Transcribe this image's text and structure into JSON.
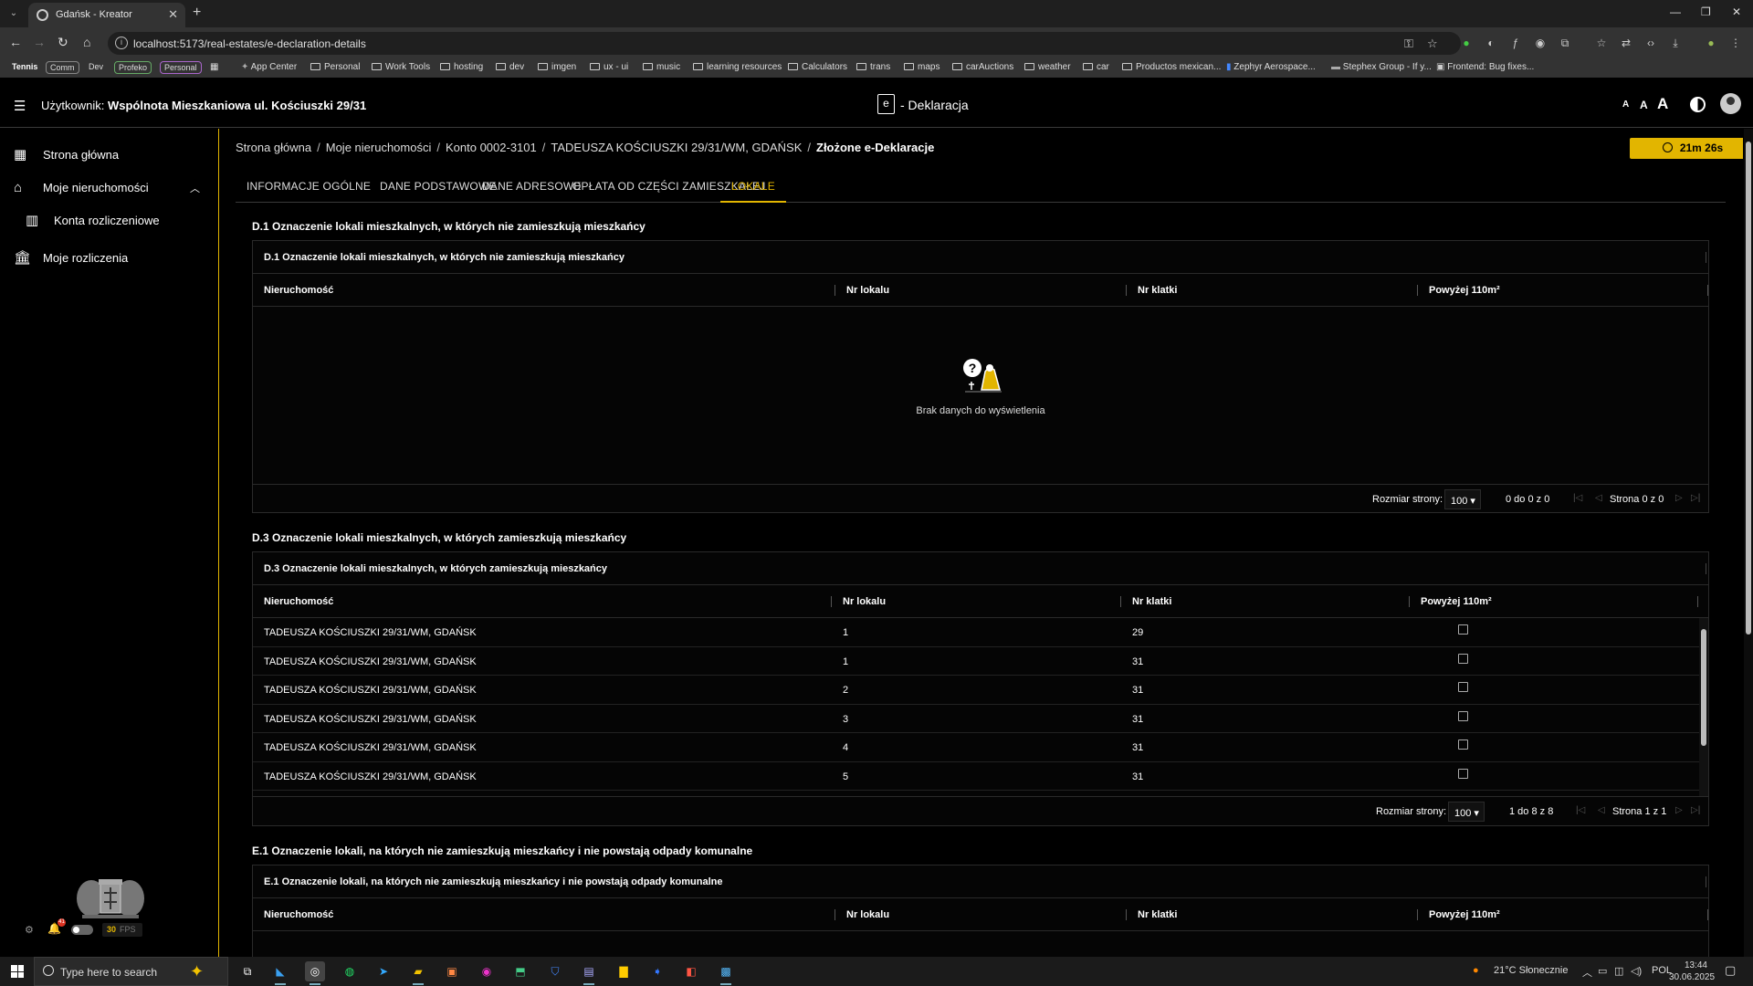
{
  "browser": {
    "tab_title": "Gdańsk - Kreator",
    "url": "localhost:5173/real-estates/e-declaration-details",
    "bookmarks": [
      {
        "label": "Tennis",
        "type": "pill"
      },
      {
        "label": "Comm",
        "type": "pill"
      },
      {
        "label": "Dev",
        "type": "pill"
      },
      {
        "label": "Profeko",
        "type": "pill"
      },
      {
        "label": "Personal",
        "type": "pill"
      },
      {
        "label": "App Center",
        "type": "link"
      },
      {
        "label": "Personal",
        "type": "folder"
      },
      {
        "label": "Work Tools",
        "type": "folder"
      },
      {
        "label": "hosting",
        "type": "folder"
      },
      {
        "label": "dev",
        "type": "folder"
      },
      {
        "label": "imgen",
        "type": "folder"
      },
      {
        "label": "ux - ui",
        "type": "folder"
      },
      {
        "label": "music",
        "type": "folder"
      },
      {
        "label": "learning resources",
        "type": "folder"
      },
      {
        "label": "Calculators",
        "type": "folder"
      },
      {
        "label": "trans",
        "type": "folder"
      },
      {
        "label": "maps",
        "type": "folder"
      },
      {
        "label": "carAuctions",
        "type": "folder"
      },
      {
        "label": "weather",
        "type": "folder"
      },
      {
        "label": "car",
        "type": "folder"
      },
      {
        "label": "Productos mexican...",
        "type": "folder"
      },
      {
        "label": "Zephyr Aerospace...",
        "type": "link"
      },
      {
        "label": "Stephex Group - If y...",
        "type": "link"
      },
      {
        "label": "Frontend: Bug fixes...",
        "type": "link"
      }
    ]
  },
  "header": {
    "user_prefix": "Użytkownik:",
    "user_name": "Wspólnota Mieszkaniowa ul. Kościuszki 29/31",
    "logo_letter": "e",
    "app_title": "- Deklaracja",
    "font_sizes": [
      "A",
      "A",
      "A"
    ]
  },
  "sidebar": {
    "items": [
      {
        "label": "Strona główna",
        "icon": "dashboard-icon"
      },
      {
        "label": "Moje nieruchomości",
        "icon": "home-icon"
      },
      {
        "label": "Konta rozliczeniowe",
        "icon": "building-icon"
      },
      {
        "label": "Moje rozliczenia",
        "icon": "bank-icon"
      }
    ],
    "notification_count": "41",
    "fps_value": "30",
    "fps_label": "FPS"
  },
  "breadcrumb": {
    "items": [
      "Strona główna",
      "Moje nieruchomości",
      "Konto 0002-3101",
      "TADEUSZA KOŚCIUSZKI 29/31/WM, GDAŃSK"
    ],
    "current": "Złożone e-Deklaracje"
  },
  "timer": "21m 26s",
  "tabs": [
    "INFORMACJE OGÓLNE",
    "DANE PODSTAWOWE",
    "DANE ADRESOWE",
    "OPŁATA OD CZĘŚCI ZAMIESZKAŁEJ",
    "LOKALE"
  ],
  "active_tab": "LOKALE",
  "columns": [
    "Nieruchomość",
    "Nr lokalu",
    "Nr klatki",
    "Powyżej 110m²"
  ],
  "sections": {
    "d1": {
      "title": "D.1 Oznaczenie lokali mieszkalnych, w których nie zamieszkują mieszkańcy",
      "panel_title": "D.1 Oznaczenie lokali mieszkalnych, w których nie zamieszkują mieszkańcy",
      "empty_text": "Brak danych do wyświetlenia",
      "page_size_label": "Rozmiar strony:",
      "page_size": "100",
      "range": "0 do 0 z 0",
      "page_info": "Strona 0 z 0"
    },
    "d3": {
      "title": "D.3 Oznaczenie lokali mieszkalnych, w których zamieszkują mieszkańcy",
      "panel_title": "D.3 Oznaczenie lokali mieszkalnych, w których zamieszkują mieszkańcy",
      "rows": [
        {
          "property": "TADEUSZA KOŚCIUSZKI 29/31/WM, GDAŃSK",
          "unit": "1",
          "stair": "29"
        },
        {
          "property": "TADEUSZA KOŚCIUSZKI 29/31/WM, GDAŃSK",
          "unit": "1",
          "stair": "31"
        },
        {
          "property": "TADEUSZA KOŚCIUSZKI 29/31/WM, GDAŃSK",
          "unit": "2",
          "stair": "31"
        },
        {
          "property": "TADEUSZA KOŚCIUSZKI 29/31/WM, GDAŃSK",
          "unit": "3",
          "stair": "31"
        },
        {
          "property": "TADEUSZA KOŚCIUSZKI 29/31/WM, GDAŃSK",
          "unit": "4",
          "stair": "31"
        },
        {
          "property": "TADEUSZA KOŚCIUSZKI 29/31/WM, GDAŃSK",
          "unit": "5",
          "stair": "31"
        }
      ],
      "page_size_label": "Rozmiar strony:",
      "page_size": "100",
      "range": "1 do 8 z 8",
      "page_info": "Strona 1 z 1"
    },
    "e1": {
      "title": "E.1 Oznaczenie lokali, na których nie zamieszkują mieszkańcy i nie powstają odpady komunalne",
      "panel_title": "E.1 Oznaczenie lokali, na których nie zamieszkują mieszkańcy i nie powstają odpady komunalne"
    }
  },
  "taskbar": {
    "search_placeholder": "Type here to search",
    "weather": "21°C  Słonecznie",
    "lang": "POL",
    "time": "13:44",
    "date": "30.06.2025"
  },
  "colors": {
    "accent": "#e2b500",
    "background": "#000000",
    "border": "#2a2a2a"
  }
}
